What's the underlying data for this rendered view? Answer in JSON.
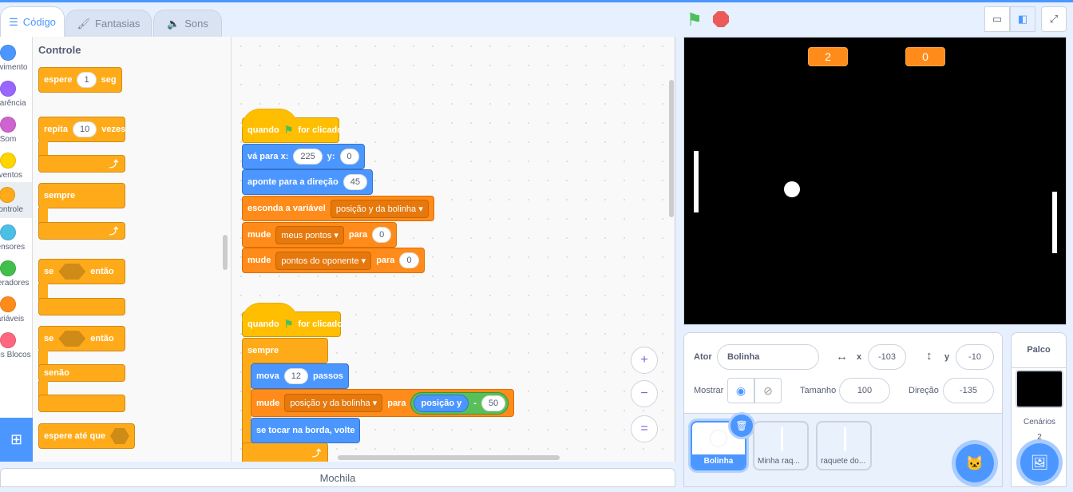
{
  "tabs": [
    {
      "label": "Código",
      "icon": "code-icon"
    },
    {
      "label": "Fantasias",
      "icon": "brush-icon"
    },
    {
      "label": "Sons",
      "icon": "speaker-icon"
    }
  ],
  "categories": [
    {
      "label": "Movimento",
      "color": "#4c97ff"
    },
    {
      "label": "Aparência",
      "color": "#9966ff"
    },
    {
      "label": "Som",
      "color": "#cf63cf"
    },
    {
      "label": "Eventos",
      "color": "#ffd500"
    },
    {
      "label": "Controle",
      "color": "#ffab19"
    },
    {
      "label": "Sensores",
      "color": "#4cbfe6"
    },
    {
      "label": "Operadores",
      "color": "#40bf4a"
    },
    {
      "label": "Variáveis",
      "color": "#ff8c1a"
    },
    {
      "label": "Meus Blocos",
      "color": "#ff6680"
    }
  ],
  "palette": {
    "heading": "Controle",
    "wait": {
      "a": "espere",
      "v": "1",
      "b": "seg"
    },
    "repeat": {
      "a": "repita",
      "v": "10",
      "b": "vezes"
    },
    "forever": "sempre",
    "if": {
      "a": "se",
      "b": "então"
    },
    "ifelse": {
      "a": "se",
      "b": "então",
      "c": "senão"
    },
    "waituntil": "espere até que"
  },
  "script1": {
    "hat": {
      "a": "quando",
      "b": "for clicado"
    },
    "goto": {
      "a": "vá para x:",
      "x": "225",
      "b": "y:",
      "y": "0"
    },
    "point": {
      "a": "aponte para a direção",
      "v": "45"
    },
    "hide": {
      "a": "esconda a variável",
      "v": "posição y da bolinha"
    },
    "set1": {
      "a": "mude",
      "v": "meus pontos",
      "b": "para",
      "n": "0"
    },
    "set2": {
      "a": "mude",
      "v": "pontos do oponente",
      "b": "para",
      "n": "0"
    }
  },
  "script2": {
    "hat": {
      "a": "quando",
      "b": "for clicado"
    },
    "forever": "sempre",
    "move": {
      "a": "mova",
      "v": "12",
      "b": "passos"
    },
    "set": {
      "a": "mude",
      "v": "posição y da bolinha",
      "b": "para",
      "r": "posição y",
      "op": "-",
      "n": "50"
    },
    "bounce": "se tocar na borda, volte"
  },
  "zoom": {
    "in": "+",
    "out": "−",
    "reset": "="
  },
  "backpack": "Mochila",
  "stage": {
    "monitors": [
      "2",
      "0"
    ]
  },
  "sprite_info": {
    "sprite_label": "Ator",
    "sprite_name": "Bolinha",
    "x_label": "x",
    "x": "-103",
    "y_label": "y",
    "y": "-10",
    "show_label": "Mostrar",
    "size_label": "Tamanho",
    "size": "100",
    "direction_label": "Direção",
    "direction": "-135"
  },
  "sprites": [
    {
      "name": "Bolinha",
      "selected": true
    },
    {
      "name": "Minha raq..."
    },
    {
      "name": "raquete do..."
    }
  ],
  "stage_panel": {
    "title": "Palco",
    "backdrops_label": "Cenários",
    "backdrops_count": "2"
  }
}
